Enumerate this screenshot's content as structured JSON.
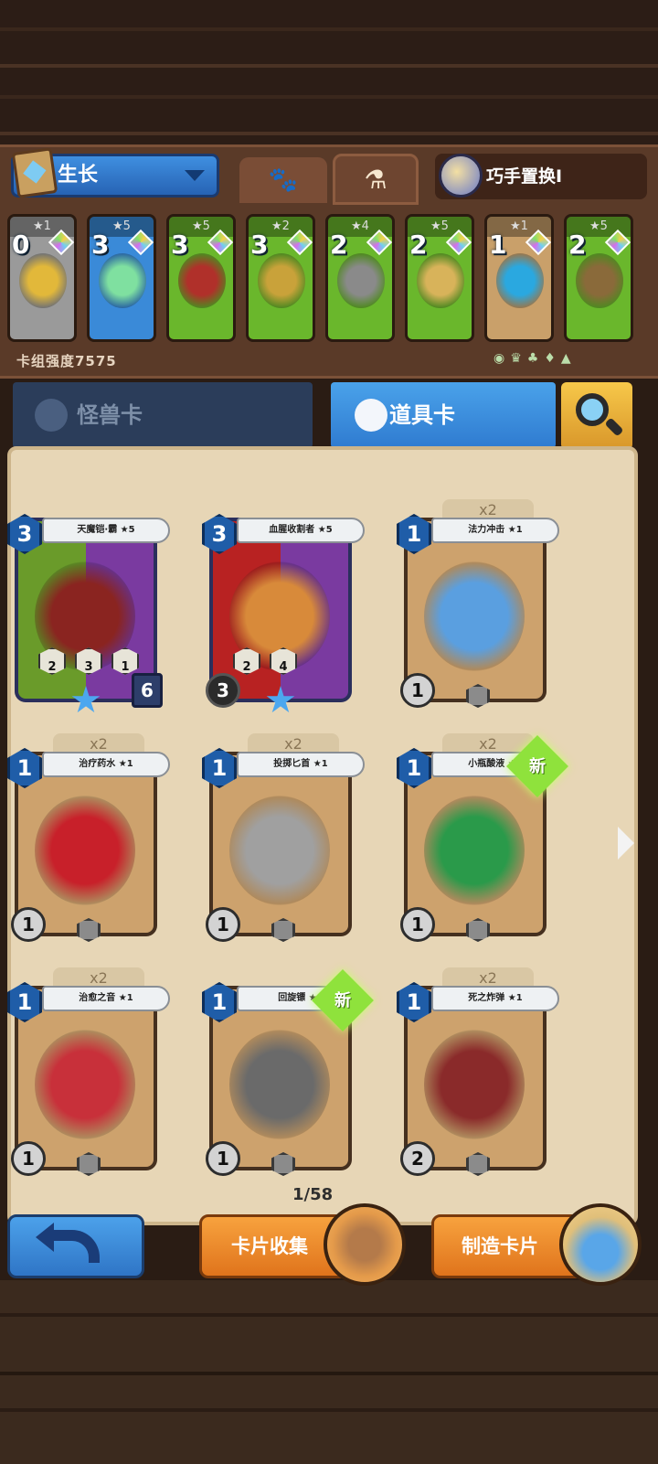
{
  "deck": {
    "name": "生长",
    "skill_label": "巧手置换I",
    "power_label": "卡组强度7575",
    "cards": [
      {
        "cost": "0",
        "stars": "★1",
        "color": "#9a9a9a",
        "art": "#e2b83a"
      },
      {
        "cost": "3",
        "stars": "★5",
        "color": "#3a8ad8",
        "art": "#7fe0a0"
      },
      {
        "cost": "3",
        "stars": "★5",
        "color": "#6ab72c",
        "art": "#b0302a"
      },
      {
        "cost": "3",
        "stars": "★2",
        "color": "#6ab72c",
        "art": "#c9a23a"
      },
      {
        "cost": "2",
        "stars": "★4",
        "color": "#6ab72c",
        "art": "#8a8a8a"
      },
      {
        "cost": "2",
        "stars": "★5",
        "color": "#6ab72c",
        "art": "#d8b35a"
      },
      {
        "cost": "1",
        "stars": "★1",
        "color": "#c9a06a",
        "art": "#2aa8e0"
      },
      {
        "cost": "2",
        "stars": "★5",
        "color": "#6ab72c",
        "art": "#8a6a3a"
      }
    ]
  },
  "tabs": {
    "monster_label": "怪兽卡",
    "item_label": "道具卡"
  },
  "cards": [
    {
      "name": "天魔铠·霸 ★5",
      "cost": "3",
      "qty": "",
      "atk": "",
      "hp": "6",
      "stats": [
        "2",
        "3",
        "1"
      ],
      "big": true,
      "frame": "#6a9b2a",
      "art": "#8a2420",
      "is_new": false
    },
    {
      "name": "血腥收割者 ★5",
      "cost": "3",
      "qty": "",
      "atk": "3",
      "hp": "",
      "stats": [
        "2",
        "4"
      ],
      "big": true,
      "frame": "#b82222",
      "art": "#d88a3a",
      "is_new": false
    },
    {
      "name": "法力冲击 ★1",
      "cost": "1",
      "qty": "x2",
      "atk": "1",
      "art": "#5a9fe0",
      "is_new": false
    },
    {
      "name": "治疗药水 ★1",
      "cost": "1",
      "qty": "x2",
      "atk": "1",
      "art": "#c8202a",
      "is_new": false
    },
    {
      "name": "投掷匕首 ★1",
      "cost": "1",
      "qty": "x2",
      "atk": "1",
      "art": "#a0a0a0",
      "is_new": false
    },
    {
      "name": "小瓶酸液 ★1",
      "cost": "1",
      "qty": "x2",
      "atk": "1",
      "art": "#2a9a4a",
      "is_new": true
    },
    {
      "name": "治愈之音 ★1",
      "cost": "1",
      "qty": "x2",
      "atk": "1",
      "art": "#c8303a",
      "is_new": false
    },
    {
      "name": "回旋镖 ★1",
      "cost": "1",
      "qty": "",
      "atk": "1",
      "art": "#6a6a6a",
      "is_new": true
    },
    {
      "name": "死之炸弹 ★1",
      "cost": "1",
      "qty": "x2",
      "atk": "2",
      "art": "#8a2a2a",
      "is_new": false
    }
  ],
  "new_badge": "新",
  "page_count": "1/58",
  "buttons": {
    "collect": "卡片收集",
    "craft": "制造卡片"
  },
  "icons": {
    "search": "magnifier-icon",
    "back": "back-arrow-icon",
    "next": "arrow-right-icon"
  }
}
